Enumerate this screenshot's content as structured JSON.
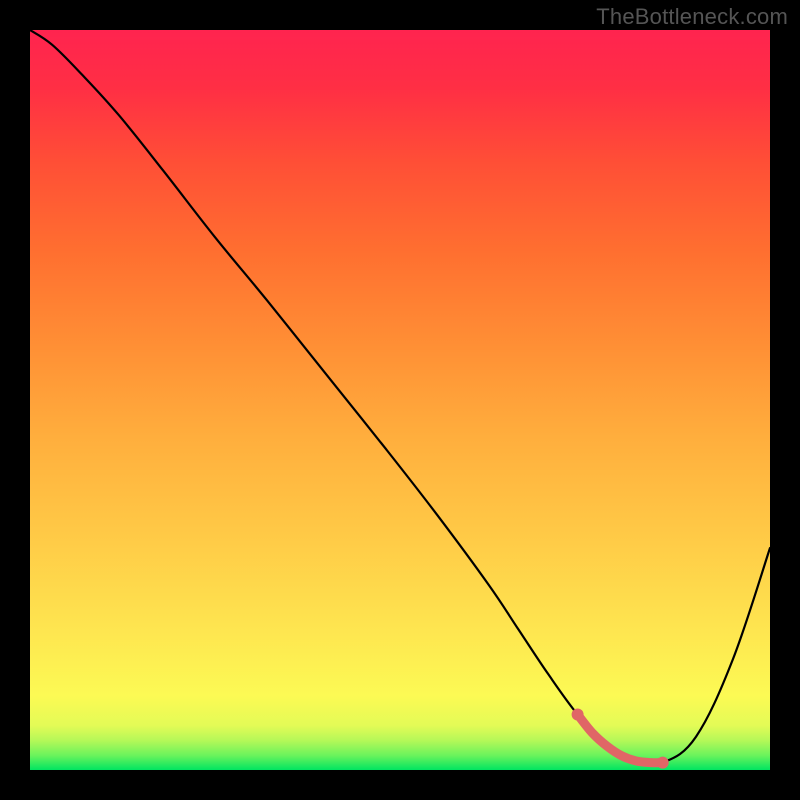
{
  "watermark": "TheBottleneck.com",
  "chart_data": {
    "type": "line",
    "title": "",
    "xlabel": "",
    "ylabel": "",
    "xlim": [
      0,
      100
    ],
    "ylim": [
      0,
      100
    ],
    "grid": false,
    "series": [
      {
        "name": "bottleneck-curve",
        "color": "#000000",
        "x": [
          0,
          3,
          7,
          12,
          18,
          25,
          32,
          40,
          48,
          55,
          62,
          66,
          70,
          74,
          78,
          82,
          85.5,
          90,
          95,
          100
        ],
        "values": [
          100,
          98,
          94,
          88.5,
          81,
          72,
          63.5,
          53.5,
          43.5,
          34.5,
          25,
          19,
          13,
          7.5,
          3.2,
          1.2,
          1.0,
          4.5,
          15,
          30
        ]
      },
      {
        "name": "optimal-range",
        "color": "#e06666",
        "x": [
          74,
          76,
          78,
          80,
          82,
          84,
          85.5
        ],
        "values": [
          7.5,
          5.0,
          3.2,
          1.9,
          1.2,
          1.0,
          1.0
        ]
      }
    ],
    "annotations": []
  }
}
